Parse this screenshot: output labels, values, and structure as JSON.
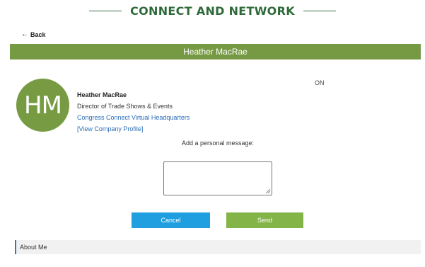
{
  "header": {
    "title": "CONNECT AND NETWORK"
  },
  "nav": {
    "back_label": "Back",
    "back_icon": "arrow-left-icon"
  },
  "profile": {
    "bar_name": "Heather MacRae",
    "initials": "HM",
    "status": "ON",
    "name": "Heather MacRae",
    "job_title": "Director of Trade Shows & Events",
    "company": "Congress Connect Virtual Headquarters",
    "view_company_link": "[View Company Profile]",
    "avatar_color": "#779b43"
  },
  "message": {
    "label": "Add a personal message:",
    "value": "",
    "placeholder": ""
  },
  "actions": {
    "cancel_label": "Cancel",
    "send_label": "Send",
    "cancel_color": "#1f9fdf",
    "send_color": "#83b447"
  },
  "sections": {
    "about_me": "About Me"
  },
  "colors": {
    "brand_green": "#2e6a39",
    "name_bar": "#769944",
    "link_blue": "#2a6eb8"
  }
}
